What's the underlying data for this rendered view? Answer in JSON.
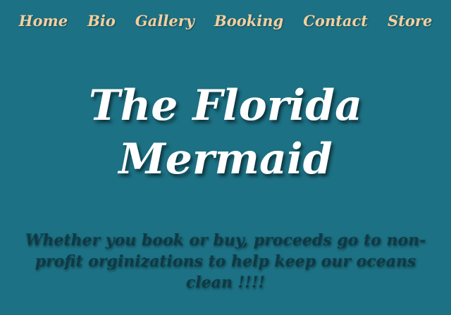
{
  "nav": {
    "items": [
      {
        "label": "Home"
      },
      {
        "label": "Bio"
      },
      {
        "label": "Gallery"
      },
      {
        "label": "Booking"
      },
      {
        "label": "Contact"
      },
      {
        "label": "Store"
      }
    ]
  },
  "hero": {
    "title_line1": "The Florida",
    "title_line2": "Mermaid"
  },
  "tagline": {
    "text": "Whether you book or buy, proceeds go to non-profit orginizations to help keep our oceans clean !!!!"
  },
  "colors": {
    "background": "#1c7184",
    "nav_text": "#f3cfa0",
    "title_text": "#ffffff",
    "tagline_text": "#0e3a45"
  }
}
